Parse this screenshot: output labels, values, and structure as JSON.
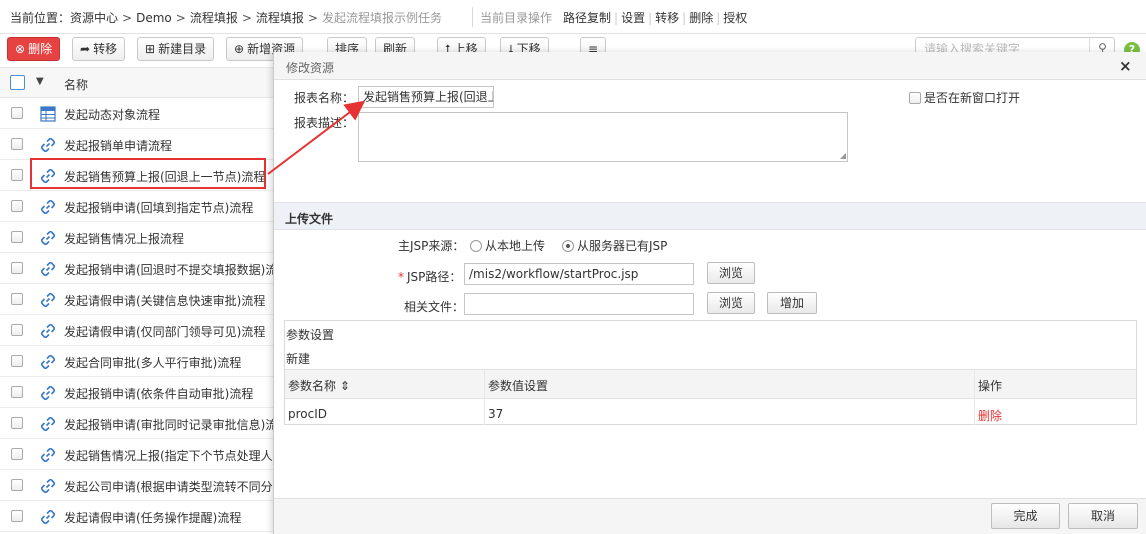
{
  "breadcrumb": {
    "label": "当前位置：",
    "items": [
      "资源中心",
      "Demo",
      "流程填报",
      "流程填报",
      "发起流程填报示例任务"
    ],
    "separator": ">"
  },
  "dir_ops": {
    "label": "当前目录操作",
    "items": [
      "路径复制",
      "设置",
      "转移",
      "删除",
      "授权"
    ]
  },
  "toolbar": {
    "delete": "删除",
    "move": "转移",
    "new_dir": "新建目录",
    "new_res": "新增资源",
    "sort": "排序",
    "refresh": "刷新",
    "up": "上移",
    "down": "下移",
    "menu": "≡",
    "search_placeholder": "请输入搜索关键字"
  },
  "list": {
    "header": "名称",
    "rows": [
      {
        "label": "发起动态对象流程",
        "icon": "report-icon"
      },
      {
        "label": "发起报销单申请流程",
        "icon": "link-icon"
      },
      {
        "label": "发起销售预算上报(回退上一节点)流程",
        "icon": "link-icon",
        "highlighted": true
      },
      {
        "label": "发起报销申请(回填到指定节点)流程",
        "icon": "link-icon"
      },
      {
        "label": "发起销售情况上报流程",
        "icon": "link-icon"
      },
      {
        "label": "发起报销申请(回退时不提交填报数据)流程",
        "icon": "link-icon"
      },
      {
        "label": "发起请假申请(关键信息快速审批)流程",
        "icon": "link-icon"
      },
      {
        "label": "发起请假申请(仅同部门领导可见)流程",
        "icon": "link-icon"
      },
      {
        "label": "发起合同审批(多人平行审批)流程",
        "icon": "link-icon"
      },
      {
        "label": "发起报销申请(依条件自动审批)流程",
        "icon": "link-icon"
      },
      {
        "label": "发起报销申请(审批同时记录审批信息)流程",
        "icon": "link-icon"
      },
      {
        "label": "发起销售情况上报(指定下个节点处理人)流程",
        "icon": "link-icon"
      },
      {
        "label": "发起公司申请(根据申请类型流转不同分支)流程",
        "icon": "link-icon"
      },
      {
        "label": "发起请假申请(任务操作提醒)流程",
        "icon": "link-icon"
      }
    ]
  },
  "modal": {
    "title": "修改资源",
    "close": "×",
    "report_name_label": "报表名称：",
    "report_name_value": "发起销售预算上报(回退上",
    "report_desc_label": "报表描述：",
    "new_window_label": "是否在新窗口打开",
    "upload_section": "上传文件",
    "jsp_source_label": "主JSP来源：",
    "jsp_source_options": [
      "从本地上传",
      "从服务器已有JSP"
    ],
    "jsp_source_selected": "从服务器已有JSP",
    "jsp_path_label": "JSP路径：",
    "jsp_path_value": "/mis2/workflow/startProc.jsp",
    "related_files_label": "相关文件：",
    "browse": "浏览",
    "add": "增加",
    "params_title": "参数设置",
    "params_new": "新建",
    "params_columns": [
      "参数名称 ⇕",
      "参数值设置",
      "操作"
    ],
    "params_rows": [
      {
        "name": "procID",
        "value": "37",
        "action": "删除"
      }
    ],
    "ok": "完成",
    "cancel": "取消"
  },
  "colors": {
    "danger": "#e64242",
    "highlight": "#e53333",
    "help": "#7ac142"
  }
}
